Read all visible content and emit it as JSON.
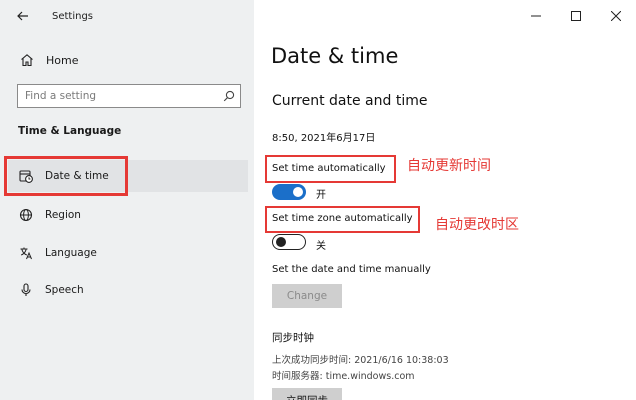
{
  "app": {
    "title": "Settings"
  },
  "sidebar": {
    "home_label": "Home",
    "search_placeholder": "Find a setting",
    "section_label": "Time & Language",
    "items": [
      {
        "label": "Date & time",
        "icon": "clock-calendar-icon",
        "active": true
      },
      {
        "label": "Region",
        "icon": "globe-icon",
        "active": false
      },
      {
        "label": "Language",
        "icon": "language-icon",
        "active": false
      },
      {
        "label": "Speech",
        "icon": "microphone-icon",
        "active": false
      }
    ]
  },
  "window_controls": {
    "minimize": "minimize-icon",
    "maximize": "maximize-icon",
    "close": "close-icon"
  },
  "main": {
    "page_title": "Date & time",
    "sub_title": "Current date and time",
    "current_datetime": "8:50, 2021年6月17日",
    "set_time_auto": {
      "label": "Set time automatically",
      "state": "开",
      "on": true
    },
    "set_timezone_auto": {
      "label": "Set time zone automatically",
      "state": "关",
      "on": false
    },
    "manual": {
      "label": "Set the date and time manually",
      "button": "Change"
    },
    "sync": {
      "title": "同步时钟",
      "last_sync": "上次成功同步时间: 2021/6/16 10:38:03",
      "server": "时间服务器: time.windows.com",
      "button": "立即同步"
    }
  },
  "annotations": {
    "auto_time": "自动更新时间",
    "auto_timezone": "自动更改时区"
  },
  "colors": {
    "accent": "#1b6fc9",
    "highlight": "#e53935",
    "sidebar_bg": "#eef0f1"
  }
}
